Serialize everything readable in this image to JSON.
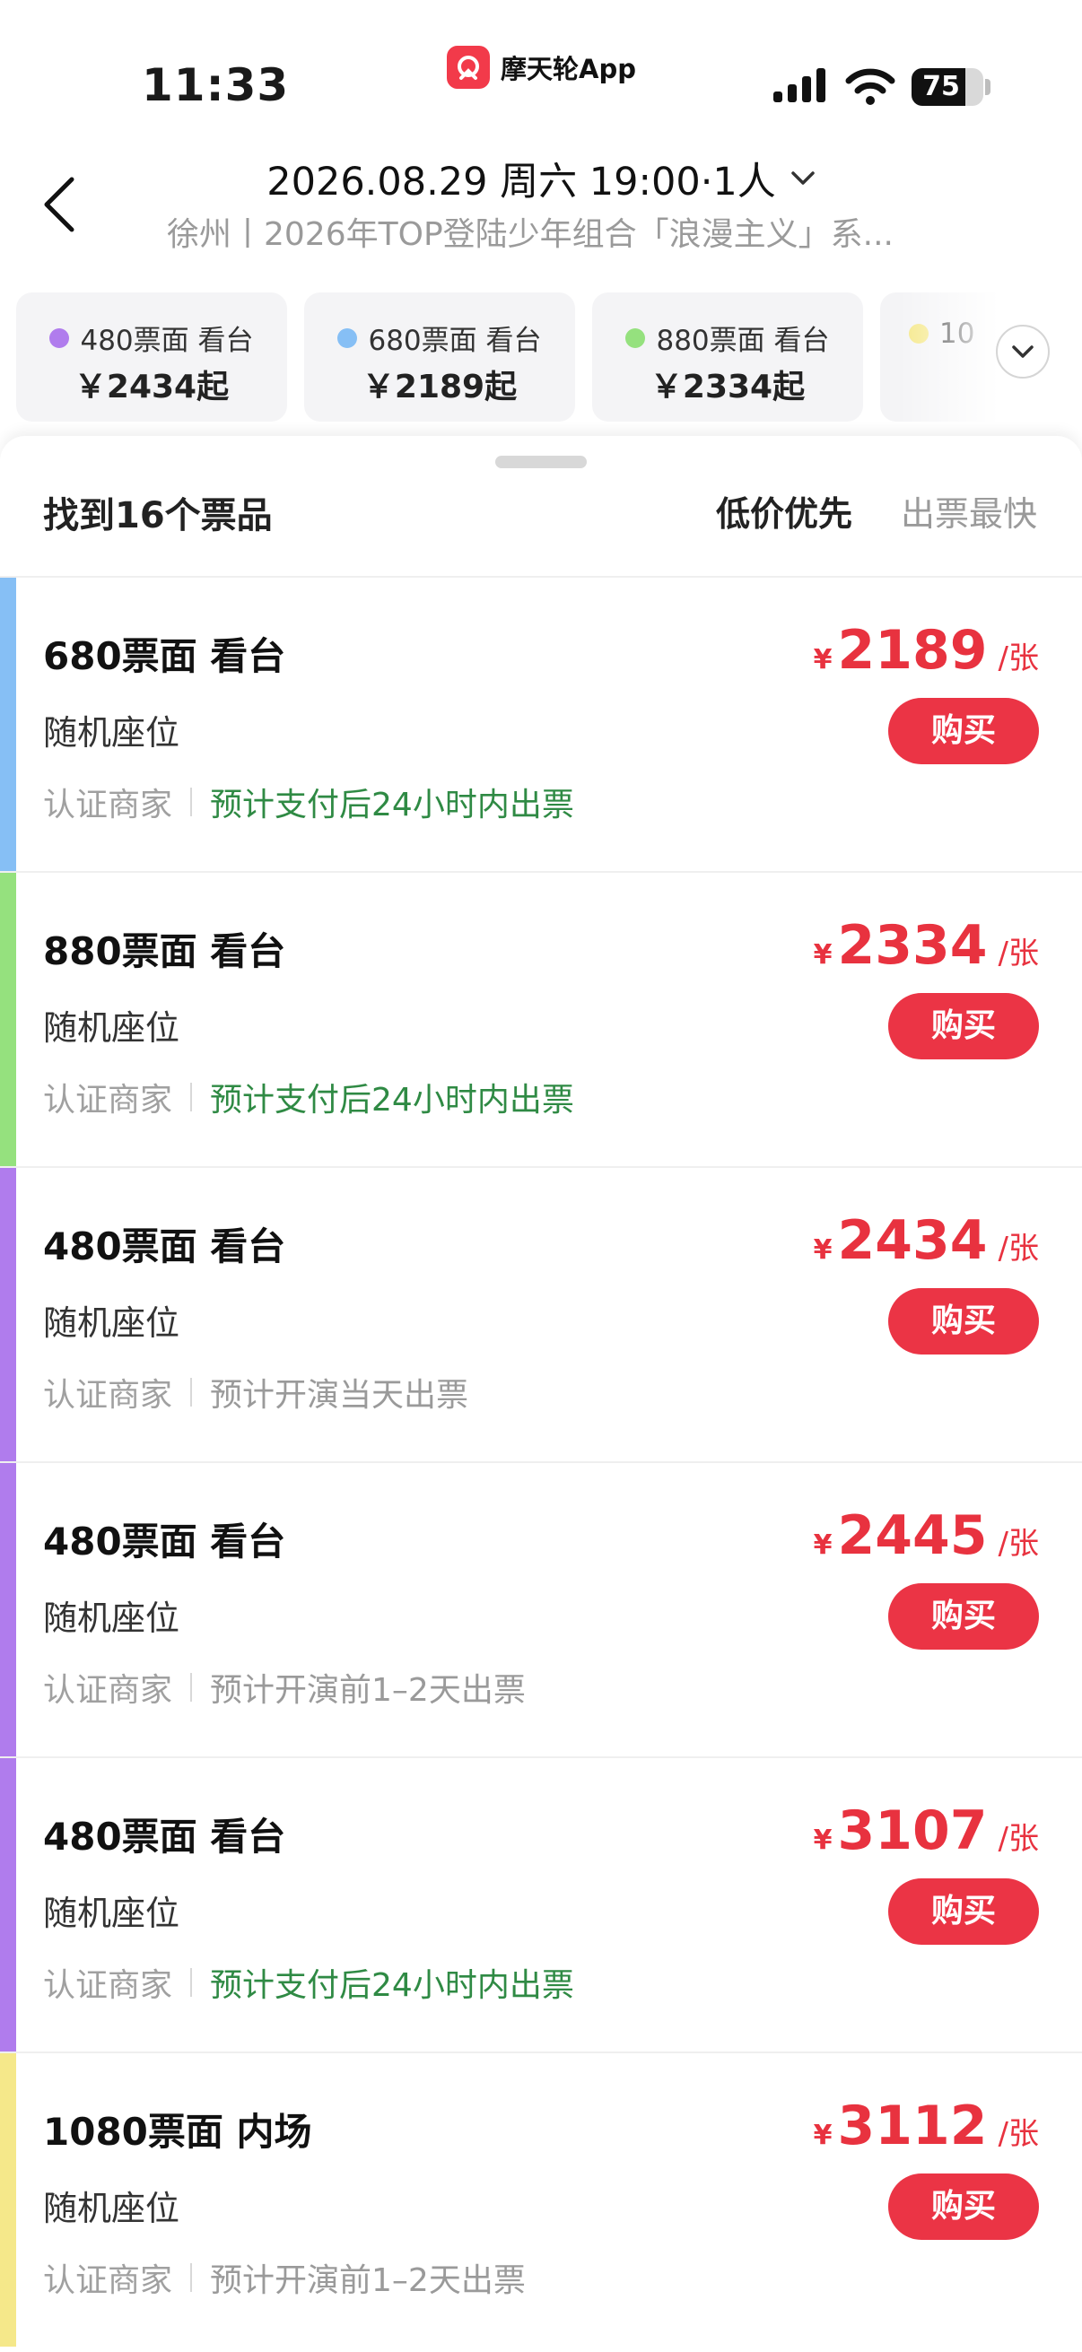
{
  "status_bar": {
    "time": "11:33",
    "source_app": "摩天轮App",
    "battery_level": "75",
    "battery_fraction": 0.75
  },
  "header": {
    "date_line": "2026.08.29 周六 19:00·1人",
    "subtitle": "徐州丨2026年TOP登陆少年组合「浪漫主义」系..."
  },
  "tiers": [
    {
      "name": "480票面 看台",
      "price": "￥2434起",
      "color": "#b07ced"
    },
    {
      "name": "680票面 看台",
      "price": "￥2189起",
      "color": "#86bff5"
    },
    {
      "name": "880票面 看台",
      "price": "￥2334起",
      "color": "#95e17e"
    },
    {
      "name": "10",
      "price": "",
      "color": "#f5e88a"
    }
  ],
  "list_header": {
    "result_count": "找到16个票品",
    "sort_low_price": "低价优先",
    "sort_fastest": "出票最快"
  },
  "tickets": [
    {
      "title": "680票面 看台",
      "seat": "随机座位",
      "merchant": "认证商家",
      "eta": "预计支付后24小时内出票",
      "eta_fast": true,
      "currency": "¥",
      "price": "2189",
      "unit": "/张",
      "buy": "购买",
      "stripe": "#86bff5"
    },
    {
      "title": "880票面 看台",
      "seat": "随机座位",
      "merchant": "认证商家",
      "eta": "预计支付后24小时内出票",
      "eta_fast": true,
      "currency": "¥",
      "price": "2334",
      "unit": "/张",
      "buy": "购买",
      "stripe": "#95e17e"
    },
    {
      "title": "480票面 看台",
      "seat": "随机座位",
      "merchant": "认证商家",
      "eta": "预计开演当天出票",
      "eta_fast": false,
      "currency": "¥",
      "price": "2434",
      "unit": "/张",
      "buy": "购买",
      "stripe": "#b07ced"
    },
    {
      "title": "480票面 看台",
      "seat": "随机座位",
      "merchant": "认证商家",
      "eta": "预计开演前1–2天出票",
      "eta_fast": false,
      "currency": "¥",
      "price": "2445",
      "unit": "/张",
      "buy": "购买",
      "stripe": "#b07ced"
    },
    {
      "title": "480票面 看台",
      "seat": "随机座位",
      "merchant": "认证商家",
      "eta": "预计支付后24小时内出票",
      "eta_fast": true,
      "currency": "¥",
      "price": "3107",
      "unit": "/张",
      "buy": "购买",
      "stripe": "#b07ced"
    },
    {
      "title": "1080票面 内场",
      "seat": "随机座位",
      "merchant": "认证商家",
      "eta": "预计开演前1–2天出票",
      "eta_fast": false,
      "currency": "¥",
      "price": "3112",
      "unit": "/张",
      "buy": "购买",
      "stripe": "#f5e88a"
    }
  ],
  "colors": {
    "accent_red": "#eb3445",
    "price_red": "#e8323f",
    "eta_green": "#2f8a44"
  }
}
